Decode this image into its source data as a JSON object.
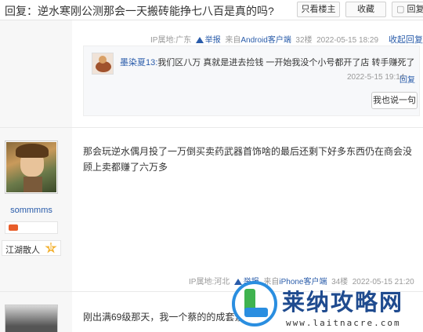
{
  "header": {
    "title": "回复：逆水寒刚公测那会一天搬砖能挣七八百是真的吗?",
    "only_author": "只看楼主",
    "favorite": "收藏",
    "reply": "回复"
  },
  "post1": {
    "ip": "IP属地:广东",
    "report": "举报",
    "source": "来自Android客户端",
    "floor": "32楼",
    "time": "2022-05-15 18:29",
    "collapse": "收起回复",
    "sub_reply": {
      "user": "墨染夏13:",
      "text": "我们区八万 真就是进去捡钱 一开始我没个小号都开了店 转手赚死了",
      "time": "2022-5-15 19:14",
      "reply_link": "回复",
      "say_button": "我也说一句"
    }
  },
  "post2": {
    "username": "sommmms",
    "level_name": "江湖散人",
    "level": "6",
    "content": "那会玩逆水偶月投了一万倒买卖药武器首饰啥的最后还剩下好多东西仍在商会没顾上卖都赚了六万多",
    "ip": "IP属地:河北",
    "report": "举报",
    "source": "来自iPhone客户端",
    "floor": "34楼",
    "time": "2022-05-15 21:20"
  },
  "post3": {
    "content": "刚出满69级那天，我一个蔡的的成套紫"
  },
  "watermark": {
    "title": "莱纳攻略网",
    "url": "www.laitnacre.com"
  },
  "colors": {
    "link": "#2a5caa",
    "meta": "#999999",
    "gutter": "#f7f7f7"
  }
}
